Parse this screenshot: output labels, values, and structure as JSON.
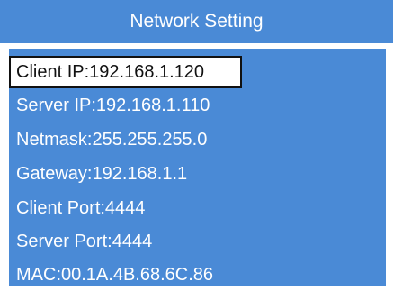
{
  "header": {
    "title": "Network Setting"
  },
  "settings": {
    "items": [
      {
        "text": "Client IP:192.168.1.120",
        "selected": true
      },
      {
        "text": "Server IP:192.168.1.110"
      },
      {
        "text": "Netmask:255.255.255.0"
      },
      {
        "text": "Gateway:192.168.1.1"
      },
      {
        "text": "Client Port:4444"
      },
      {
        "text": "Server Port:4444"
      },
      {
        "text": "MAC:00.1A.4B.68.6C.86"
      }
    ]
  },
  "colors": {
    "panel_blue": "#4a8ad6",
    "text_light": "#ffffff",
    "selected_bg": "#ffffff",
    "selected_text": "#111111"
  }
}
